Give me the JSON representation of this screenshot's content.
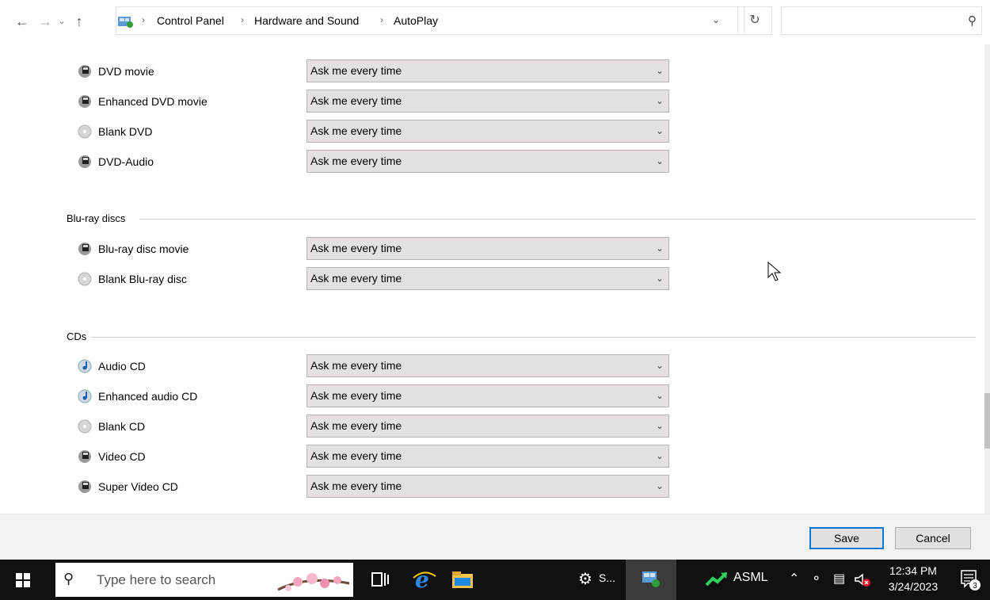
{
  "address_bar": {
    "breadcrumbs": [
      "Control Panel",
      "Hardware and Sound",
      "AutoPlay"
    ],
    "search_placeholder": ""
  },
  "groups": [
    {
      "title": "",
      "rows": [
        {
          "label": "DVD movie",
          "value": "Ask me every time",
          "icon": "dvd-film-icon"
        },
        {
          "label": "Enhanced DVD movie",
          "value": "Ask me every time",
          "icon": "dvd-film-icon"
        },
        {
          "label": "Blank DVD",
          "value": "Ask me every time",
          "icon": "blank-disc-icon"
        },
        {
          "label": "DVD-Audio",
          "value": "Ask me every time",
          "icon": "dvd-film-icon"
        }
      ]
    },
    {
      "title": "Blu-ray discs",
      "rows": [
        {
          "label": "Blu-ray disc movie",
          "value": "Ask me every time",
          "icon": "dvd-film-icon"
        },
        {
          "label": "Blank Blu-ray disc",
          "value": "Ask me every time",
          "icon": "blank-disc-icon"
        }
      ]
    },
    {
      "title": "CDs",
      "rows": [
        {
          "label": "Audio CD",
          "value": "Ask me every time",
          "icon": "audio-cd-icon"
        },
        {
          "label": "Enhanced audio CD",
          "value": "Ask me every time",
          "icon": "audio-cd-icon"
        },
        {
          "label": "Blank CD",
          "value": "Ask me every time",
          "icon": "blank-disc-icon"
        },
        {
          "label": "Video CD",
          "value": "Ask me every time",
          "icon": "dvd-film-icon"
        },
        {
          "label": "Super Video CD",
          "value": "Ask me every time",
          "icon": "dvd-film-icon"
        }
      ]
    }
  ],
  "footer": {
    "save_label": "Save",
    "cancel_label": "Cancel"
  },
  "taskbar": {
    "search_placeholder": "Type here to search",
    "settings_label": "S...",
    "stock_label": "ASML",
    "clock_time": "12:34 PM",
    "clock_date": "3/24/2023",
    "notification_count": "3"
  },
  "colors": {
    "accent": "#0078d7",
    "combo_bg": "#e5e1e1",
    "taskbar_bg": "#101010"
  }
}
